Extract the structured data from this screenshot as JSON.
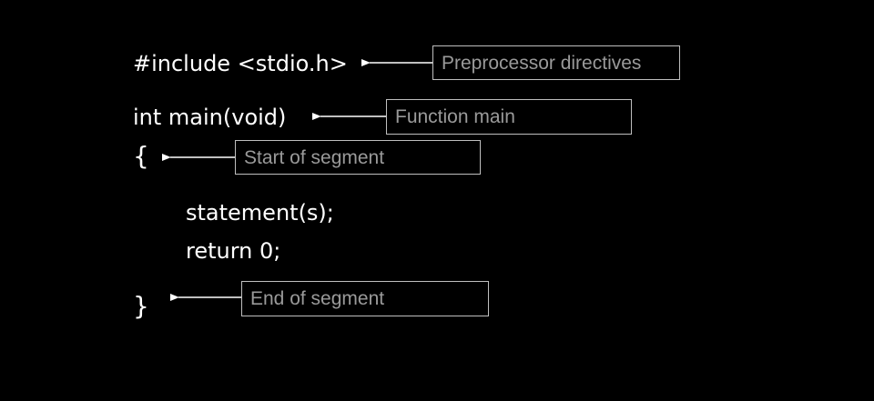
{
  "code": {
    "include_line": "#include <stdio.h>",
    "main_line": "int main(void)",
    "open_brace": "{",
    "statement_line": "statement(s);",
    "return_line": "return 0;",
    "close_brace": "}"
  },
  "labels": {
    "preprocessor": "Preprocessor directives",
    "function_main": "Function main",
    "start_segment": "Start of segment",
    "end_segment": "End of segment"
  },
  "colors": {
    "background": "#000000",
    "code_text": "#ffffff",
    "label_text": "#9a9a9a",
    "box_border": "#bfbfbf",
    "arrow": "#ffffff"
  }
}
